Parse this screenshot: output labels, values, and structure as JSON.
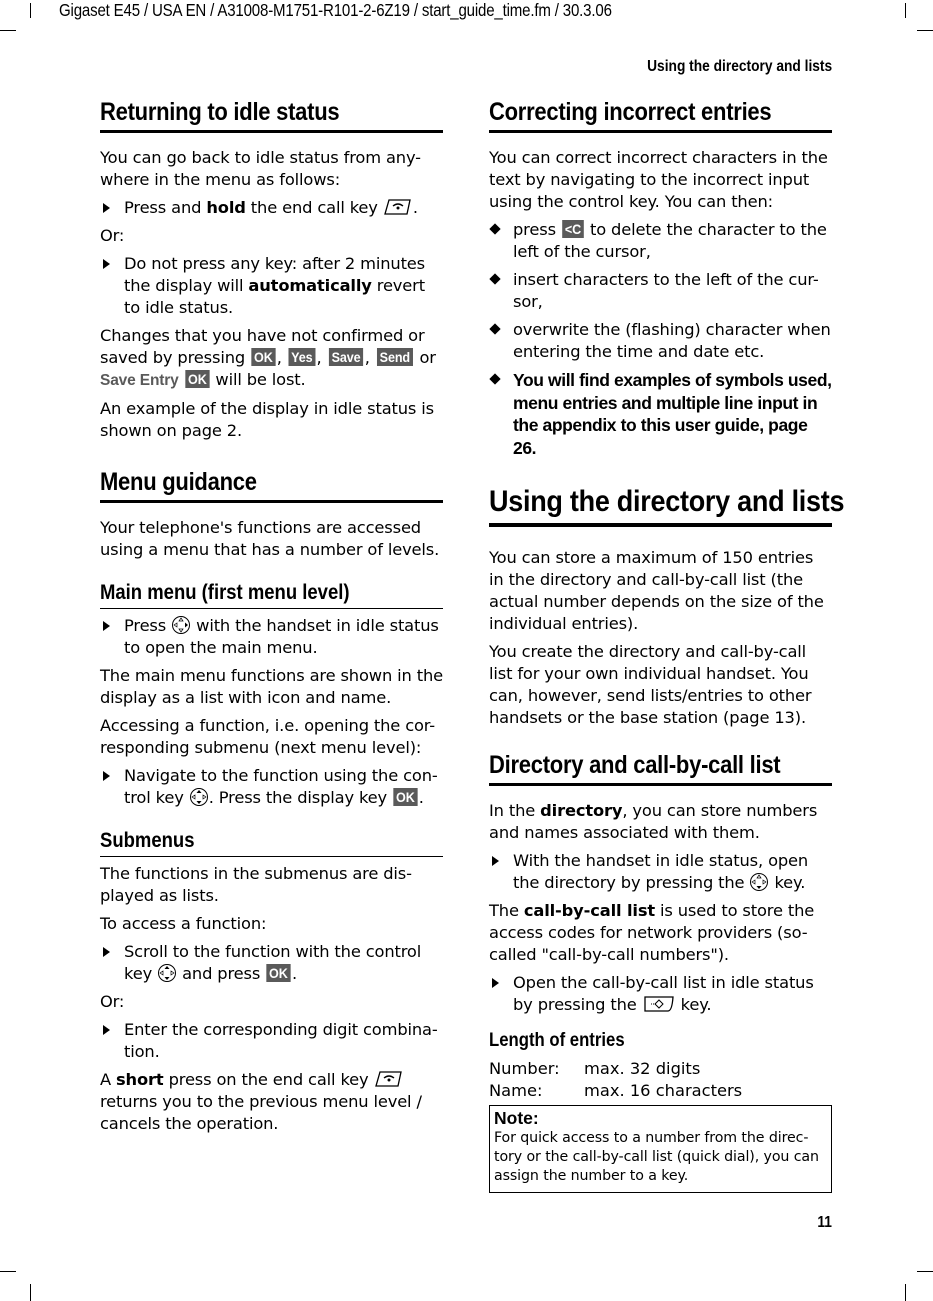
{
  "doc_header": "Gigaset E45 / USA EN / A31008-M1751-R101-2-6Z19  / start_guide_time.fm / 30.3.06",
  "running_head": "Using the directory and lists",
  "page_number": "11",
  "left": {
    "idle": {
      "title": "Returning to idle status",
      "intro": "You can go back to idle status from any-where in the menu as follows:",
      "step1_pre": "Press and ",
      "step1_bold": "hold",
      "step1_post": " the end call key ",
      "step1_end": ".",
      "or1": "Or:",
      "step2_pre": "Do not press any key: after 2 minutes the display will ",
      "step2_bold": "automatically",
      "step2_post": " revert to idle status.",
      "changes_pre": "Changes that you have not confirmed or saved by pressing ",
      "keys": [
        "OK",
        "Yes",
        "Save",
        "Send"
      ],
      "sep1": ", ",
      "sep_or": " or ",
      "menu_save_entry": "Save Entry",
      "key_ok2": "OK",
      "changes_post": " will be lost.",
      "example": "An example of the display in idle status is shown on page 2."
    },
    "menu": {
      "title": "Menu guidance",
      "intro": "Your telephone's functions are accessed using a menu that has a number of levels."
    },
    "main_menu": {
      "title": "Main menu (first menu level)",
      "step1_pre": "Press ",
      "step1_post": " with the handset in idle status to open the main menu.",
      "p1": "The main menu functions are shown in the display as a list with icon and name.",
      "p2": "Accessing a function, i.e. opening the cor-responding submenu (next menu level):",
      "step2_pre": "Navigate to the function using the con-trol key ",
      "step2_mid": ". Press the display key ",
      "step2_key": "OK",
      "step2_end": "."
    },
    "submenus": {
      "title": "Submenus",
      "p1": "The functions in the submenus are dis-played as lists.",
      "p2": "To access a function:",
      "step1_pre": "Scroll to the function with the control key ",
      "step1_mid": " and press ",
      "step1_key": "OK",
      "step1_end": ".",
      "or": "Or:",
      "step2": "Enter the corresponding digit combina-tion.",
      "short_pre": "A ",
      "short_bold": "short",
      "short_mid": " press on the end call key ",
      "short_post": " returns you to the previous menu level / cancels the operation."
    }
  },
  "right": {
    "correct": {
      "title": "Correcting incorrect entries",
      "intro": "You can correct incorrect characters in the text by navigating to the incorrect input using the control key. You can then:",
      "b1_pre": "press ",
      "b1_key": "<C",
      "b1_post": " to delete the character to the left of the cursor,",
      "b2": "insert characters to the left of the cur-sor,",
      "b3": "overwrite the (flashing) character when entering the time and date etc.",
      "b4": "You will find examples of symbols used, menu entries and multiple line input in the appendix to this user guide, page 26."
    },
    "dir_lists": {
      "title": "Using the directory and lists",
      "p1": "You can store a maximum of 150 entries in the directory and call-by-call list (the actual number depends on the size of the individual entries).",
      "p2": "You create the directory and call-by-call list for your own individual handset. You can, however, send lists/entries to other handsets or the base station (page 13)."
    },
    "dir_cbc": {
      "title": "Directory and call-by-call list",
      "p1_pre": "In the ",
      "p1_bold": "directory",
      "p1_post": ", you can store numbers and names associated with them.",
      "step1_pre": "With the handset in idle status, open the directory by pressing the ",
      "step1_post": " key.",
      "p2_pre": "The ",
      "p2_bold": "call-by-call list",
      "p2_post": " is used to store the access codes for network providers (so-called \"call-by-call numbers\").",
      "step2_pre": "Open the call-by-call list in idle status by pressing the ",
      "step2_post": " key."
    },
    "length": {
      "title": "Length of entries",
      "rows": [
        {
          "label": "Number:",
          "value": "max. 32 digits"
        },
        {
          "label": "Name:",
          "value": "max. 16 characters"
        }
      ]
    },
    "note": {
      "title": "Note:",
      "body": "For quick access to a number from the direc-tory or the call-by-call list (quick dial), you can assign the number to a key."
    }
  }
}
